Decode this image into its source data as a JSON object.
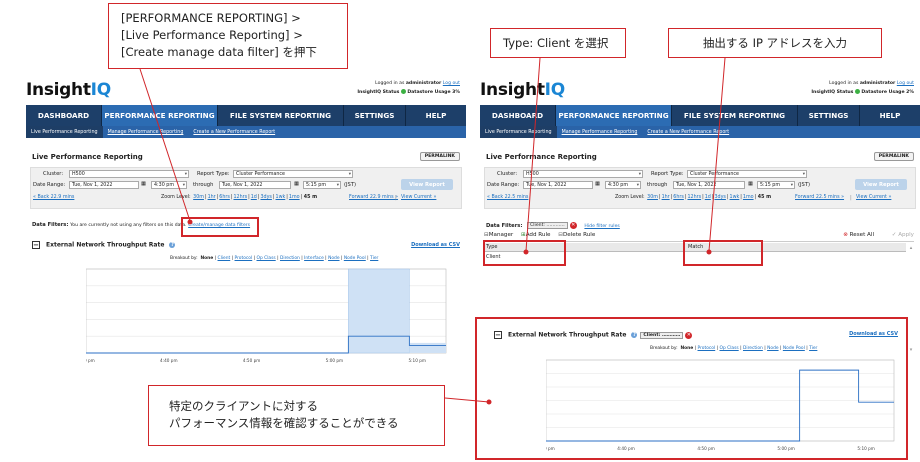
{
  "callouts": {
    "top_left_lines": [
      "[PERFORMANCE REPORTING] >",
      "[Live Performance Reporting] >",
      "[Create manage data filter] を押下"
    ],
    "top_mid": "Type: Client を選択",
    "top_right": "抽出する IP アドレスを入力",
    "bottom_lines": [
      "特定のクライアントに対する",
      "パフォーマンス情報を確認することができる"
    ]
  },
  "app": {
    "logo_main": "Insight",
    "logo_accent": "IQ",
    "login_prefix": "Logged in as",
    "user": "administrator",
    "logout": "Log out",
    "status_label": "InsightIQ Status",
    "datastore_left": "Datastore Usage 3%",
    "datastore_right": "Datastore Usage 2%",
    "nav": [
      "DASHBOARD",
      "PERFORMANCE REPORTING",
      "FILE SYSTEM REPORTING",
      "SETTINGS",
      "HELP"
    ],
    "nav_right": [
      "DASHBOARD",
      "PERFORMANCE REPORTING",
      "FILE SYSTEM REPORTING",
      "SETTINGS",
      "HELP"
    ],
    "subnav": [
      "Live Performance Reporting",
      "Manage Performance Reporting",
      "Create a New Performance Report"
    ],
    "page_title": "Live Performance Reporting",
    "permalink": "PERMALINK",
    "cluster_label": "Cluster:",
    "cluster_value": "H500",
    "report_type_label": "Report Type:",
    "report_type_value": "Cluster Performance",
    "date_range_label": "Date Range:",
    "date_from": "Tue, Nov 1, 2022",
    "time_from": "4:30 pm",
    "through": "through",
    "date_to": "Tue, Nov 1, 2022",
    "time_to": "5:15 pm",
    "tz": "(JST)",
    "view_report": "View Report",
    "back_link": "« Back 22.9 mins",
    "back_link_right": "« Back 22.5 mins",
    "zoom_label": "Zoom Level:",
    "zoom_levels": [
      "30m",
      "1hr",
      "6hrs",
      "12hrs",
      "1d",
      "3dys",
      "1wk",
      "1mo"
    ],
    "zoom_current": "45 m",
    "forward_link": "Forward 22.9 mins »",
    "forward_link_right": "Forward 22.5 mins »",
    "view_current": "View Current »",
    "data_filters_label": "Data Filters:",
    "no_filters_text": "You are currently not using any filters on this data.",
    "create_filter_link": "Create/manage data filters",
    "client_chip": "Client: …………",
    "hide_filter_rules": "Hide filter rules",
    "manager_label": "Manager",
    "add_rule": "Add Rule",
    "delete_rule": "Delete Rule",
    "reset_all": "Reset All",
    "apply": "Apply",
    "col_type": "Type",
    "col_match": "Match",
    "row_type_value": "Client",
    "chart_title": "External Network Throughput Rate",
    "download_csv": "Download as CSV",
    "breakout_label": "Breakout by:",
    "breakout_none": "None",
    "breakout_opts": [
      "Client",
      "Protocol",
      "Op Class",
      "Direction",
      "Interface",
      "Node",
      "Node Pool",
      "Tier"
    ],
    "breakout_opts_right": [
      "Protocol",
      "Op Class",
      "Direction",
      "Node",
      "Node Pool",
      "Tier"
    ]
  },
  "chart_data": [
    {
      "type": "area",
      "title": "External Network Throughput Rate",
      "x": [
        "4:30 pm",
        "4:40 pm",
        "4:50 pm",
        "5:00 pm",
        "5:10 pm"
      ],
      "ytick_labels": [
        "0 b/s",
        "2 Gb/s",
        "4 Gb/s",
        "6 Gb/s",
        "8 Gb/s",
        "10 Gb/s"
      ],
      "ylim": [
        0,
        10
      ],
      "yunit": "Gb/s",
      "series": [
        {
          "values": [
            0,
            0,
            0,
            0,
            0,
            0,
            0,
            0,
            0,
            0,
            0,
            0,
            0,
            0,
            0,
            0,
            0,
            0,
            0,
            0,
            0,
            0,
            0,
            0,
            0,
            0,
            0,
            0,
            0,
            0,
            0,
            0,
            0,
            0,
            0,
            0,
            0,
            0,
            0,
            0,
            0,
            0,
            0,
            2.0,
            2.0,
            2.0,
            2.0,
            2.0,
            2.0,
            2.0,
            2.0,
            2.0,
            2.0,
            0.9,
            0.9,
            0.9,
            0.9,
            0.9,
            0.9,
            0.9
          ]
        }
      ],
      "highlight_band_label": "5:00 pm – 5:10 pm",
      "highlight_band_value": 10
    },
    {
      "type": "line",
      "title": "External Network Throughput Rate",
      "x": [
        "4:30 pm",
        "4:40 pm",
        "4:50 pm",
        "5:00 pm",
        "5:10 pm"
      ],
      "ytick_labels": [
        "0 b/s",
        "8 Mb/s",
        "16 Mb/s",
        "24 Mb/s",
        "32 Mb/s",
        "40 Mb/s",
        "48 Mb/s"
      ],
      "ylim": [
        0,
        48
      ],
      "yunit": "Mb/s",
      "series": [
        {
          "name": "Client",
          "values": [
            0,
            0,
            0,
            0,
            0,
            0,
            0,
            0,
            0,
            0,
            0,
            0,
            0,
            0,
            0,
            0,
            0,
            0,
            0,
            0,
            0,
            0,
            0,
            0,
            0,
            0,
            0,
            0,
            0,
            0,
            0,
            0,
            0,
            0,
            0,
            0,
            0,
            0,
            0,
            0,
            0,
            0,
            0,
            42,
            42,
            42,
            42,
            42,
            42,
            42,
            42,
            42,
            42,
            23,
            23,
            23,
            23,
            23,
            23,
            23
          ]
        }
      ]
    }
  ]
}
